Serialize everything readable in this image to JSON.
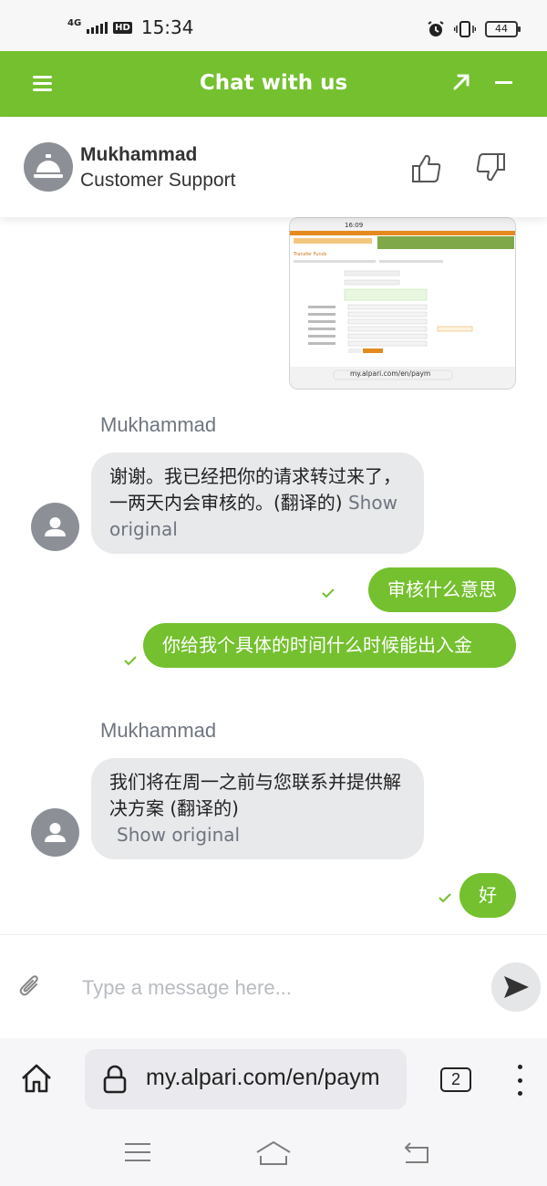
{
  "status_bar": {
    "network": "4G",
    "hd": "HD",
    "time": "15:34",
    "battery": "44"
  },
  "chat_header": {
    "title": "Chat with us"
  },
  "agent": {
    "name": "Mukhammad",
    "role": "Customer Support"
  },
  "screenshot_preview": {
    "status_time": "16:09",
    "page_title": "Transfer Funds",
    "url": "my.alpari.com/en/paym"
  },
  "messages": [
    {
      "direction": "in",
      "sender": "Mukhammad",
      "text": "谢谢。我已经把你的请求转过来了，一两天内会审核的。(翻译的)",
      "show_original": "Show original"
    },
    {
      "direction": "out",
      "text": "审核什么意思"
    },
    {
      "direction": "out",
      "text": "你给我个具体的时间什么时候能出入金"
    },
    {
      "direction": "in",
      "sender": "Mukhammad",
      "text": "我们将在周一之前与您联系并提供解决方案 (翻译的)",
      "show_original": "Show original"
    },
    {
      "direction": "out",
      "text": "好"
    }
  ],
  "composer": {
    "placeholder": "Type a message here..."
  },
  "browser": {
    "url": "my.alpari.com/en/paym",
    "tab_count": "2"
  },
  "colors": {
    "brand_green": "#74c02e",
    "incoming_bubble": "#e8e9eb",
    "avatar_gray": "#8c9096",
    "muted_text": "#6f7580"
  }
}
